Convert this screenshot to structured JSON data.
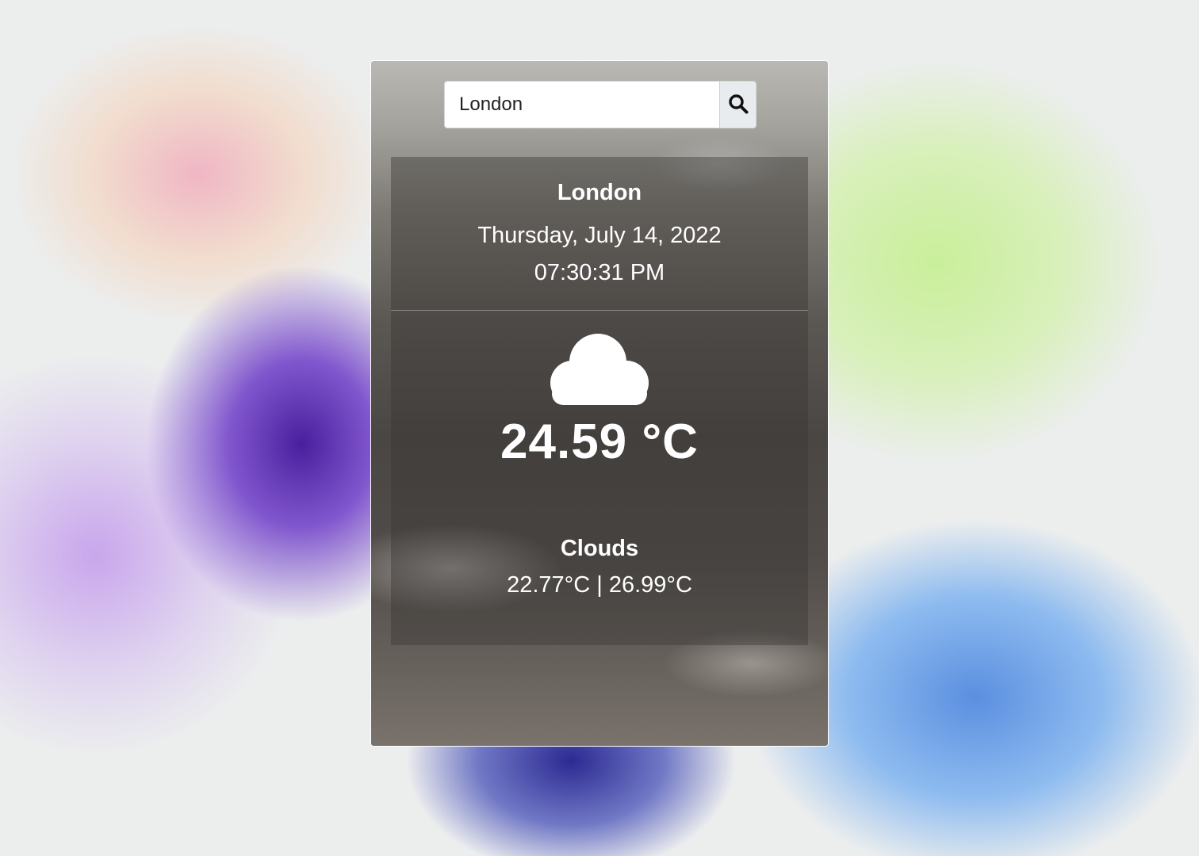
{
  "search": {
    "value": "London",
    "button_icon": "search-icon"
  },
  "weather": {
    "city": "London",
    "date": "Thursday, July 14, 2022",
    "time": "07:30:31 PM",
    "icon": "cloud-icon",
    "temperature": "24.59 °C",
    "condition": "Clouds",
    "min_max": "22.77°C | 26.99°C"
  }
}
